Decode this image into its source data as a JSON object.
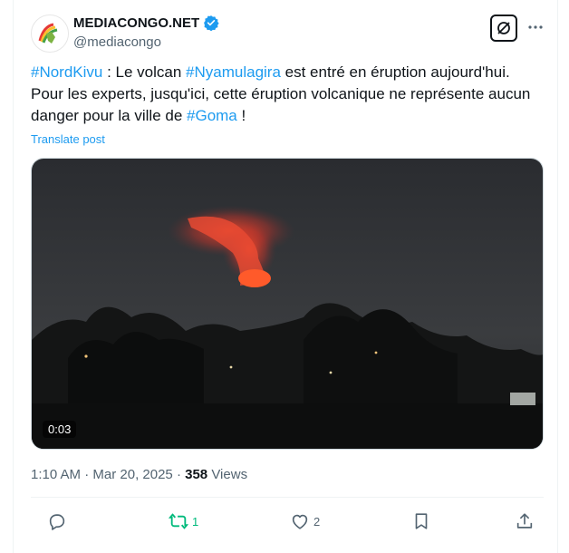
{
  "author": {
    "name": "MEDIACONGO.NET",
    "handle": "@mediacongo"
  },
  "post": {
    "segments": [
      {
        "text": "#NordKivu",
        "tag": true
      },
      {
        "text": " : Le volcan ",
        "tag": false
      },
      {
        "text": "#Nyamulagira",
        "tag": true
      },
      {
        "text": " est entré en éruption aujourd'hui. Pour les experts, jusqu'ici, cette éruption volcanique ne représente aucun danger pour la ville de ",
        "tag": false
      },
      {
        "text": "#Goma",
        "tag": true
      },
      {
        "text": " !",
        "tag": false
      }
    ],
    "translate_label": "Translate post",
    "video_duration": "0:03",
    "time": "1:10 AM",
    "separator": "·",
    "date": "Mar 20, 2025",
    "views_count": "358",
    "views_label": "Views"
  },
  "actions": {
    "reply_count": "",
    "repost_count": "1",
    "like_count": "2"
  },
  "colors": {
    "link": "#1d9bf0",
    "repost_active": "#00ba7c",
    "secondary_text": "#536471"
  },
  "icons": [
    "verified-badge-icon",
    "grok-icon",
    "more-icon",
    "reply-icon",
    "repost-icon",
    "like-icon",
    "bookmark-icon",
    "share-icon"
  ]
}
